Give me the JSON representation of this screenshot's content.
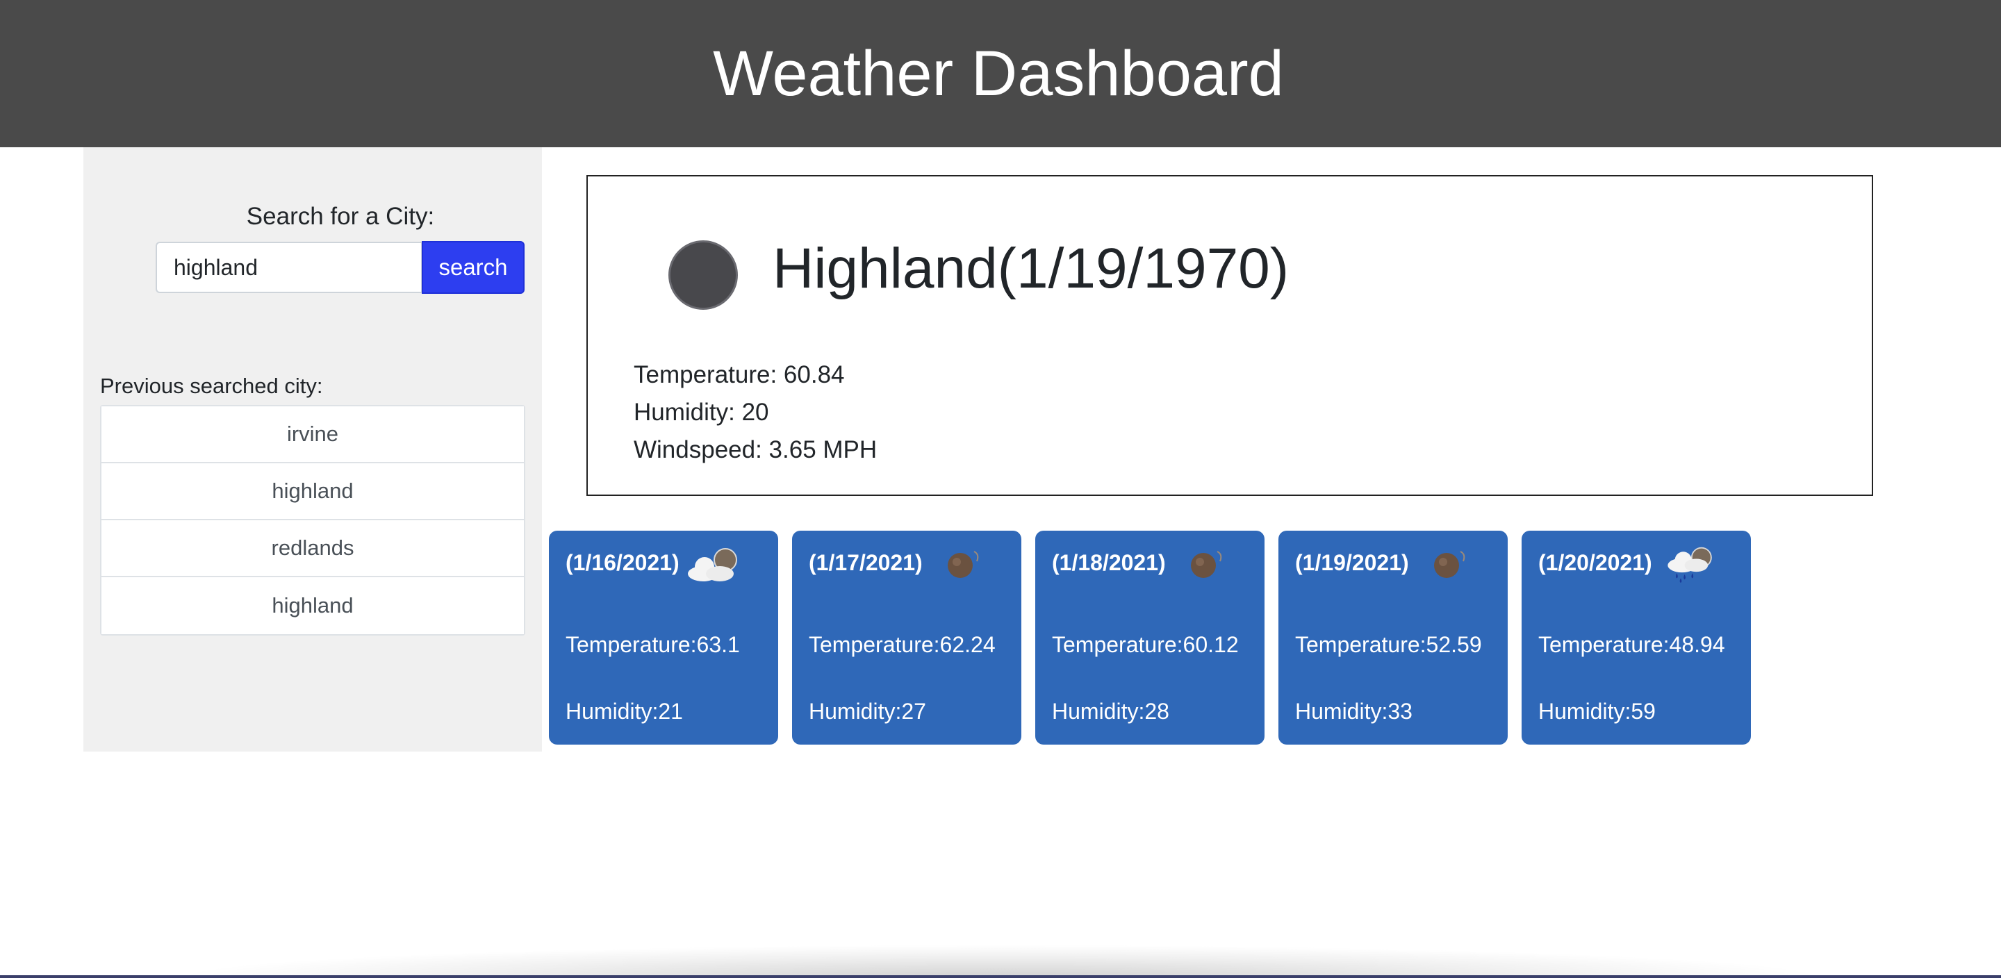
{
  "header": {
    "title": "Weather Dashboard",
    "background_color": "#4a4a4a"
  },
  "sidebar": {
    "search_label": "Search for a City:",
    "search_value": "highland",
    "search_button_label": "search",
    "search_button_color": "#2d3ef0",
    "history_label": "Previous searched city:",
    "history": [
      {
        "label": "irvine"
      },
      {
        "label": "highland"
      },
      {
        "label": "redlands"
      },
      {
        "label": "highland"
      }
    ]
  },
  "current": {
    "title": "Highland(1/19/1970)",
    "icon": "weather-icon",
    "temperature": "Temperature: 60.84",
    "humidity": "Humidity: 20",
    "windspeed": "Windspeed: 3.65 MPH"
  },
  "forecast": {
    "card_color": "#2f68b8",
    "days": [
      {
        "date": "(1/16/2021)",
        "icon": "cloudy-icon",
        "temperature": "Temperature:63.1",
        "humidity": "Humidity:21"
      },
      {
        "date": "(1/17/2021)",
        "icon": "clear-night-icon",
        "temperature": "Temperature:62.24",
        "humidity": "Humidity:27"
      },
      {
        "date": "(1/18/2021)",
        "icon": "clear-night-icon",
        "temperature": "Temperature:60.12",
        "humidity": "Humidity:28"
      },
      {
        "date": "(1/19/2021)",
        "icon": "clear-night-icon",
        "temperature": "Temperature:52.59",
        "humidity": "Humidity:33"
      },
      {
        "date": "(1/20/2021)",
        "icon": "rain-icon",
        "temperature": "Temperature:48.94",
        "humidity": "Humidity:59"
      }
    ]
  }
}
